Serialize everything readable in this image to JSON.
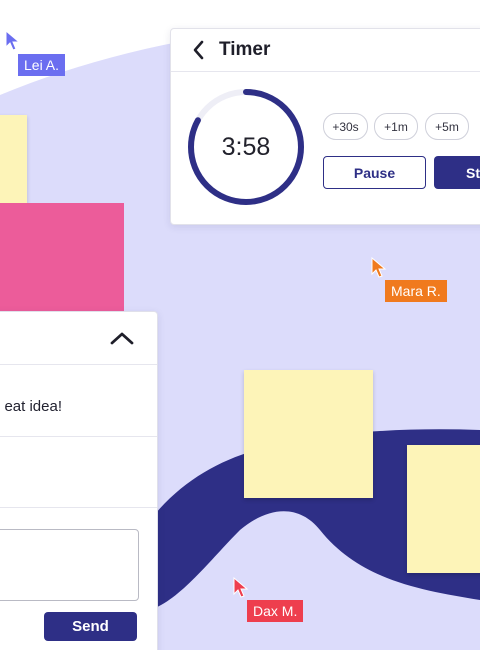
{
  "colors": {
    "lavender": "#dcdcfb",
    "navy": "#2e2f86",
    "sticky_yellow": "#fdf4b8",
    "sticky_pink": "#ec5c9a",
    "cursor_lei": "#6b6ef0",
    "cursor_mara": "#f07a1e",
    "cursor_dax": "#ee3e4e"
  },
  "cursors": [
    {
      "name": "Lei A.",
      "color": "#6b6ef0",
      "icon": "pointer-arrow-icon"
    },
    {
      "name": "Mara R.",
      "color": "#f07a1e",
      "icon": "pointer-arrow-icon"
    },
    {
      "name": "Dax M.",
      "color": "#ee3e4e",
      "icon": "pointer-arrow-icon"
    }
  ],
  "timer": {
    "title": "Timer",
    "back_icon": "chevron-left-icon",
    "time": "3:58",
    "progress": 0.83,
    "chips": [
      "+30s",
      "+1m",
      "+5m"
    ],
    "pause_label": "Pause",
    "start_label": "St"
  },
  "chat": {
    "collapse_icon": "chevron-up-icon",
    "message": "eat idea!",
    "input_placeholder": "",
    "send_label": "Send"
  }
}
